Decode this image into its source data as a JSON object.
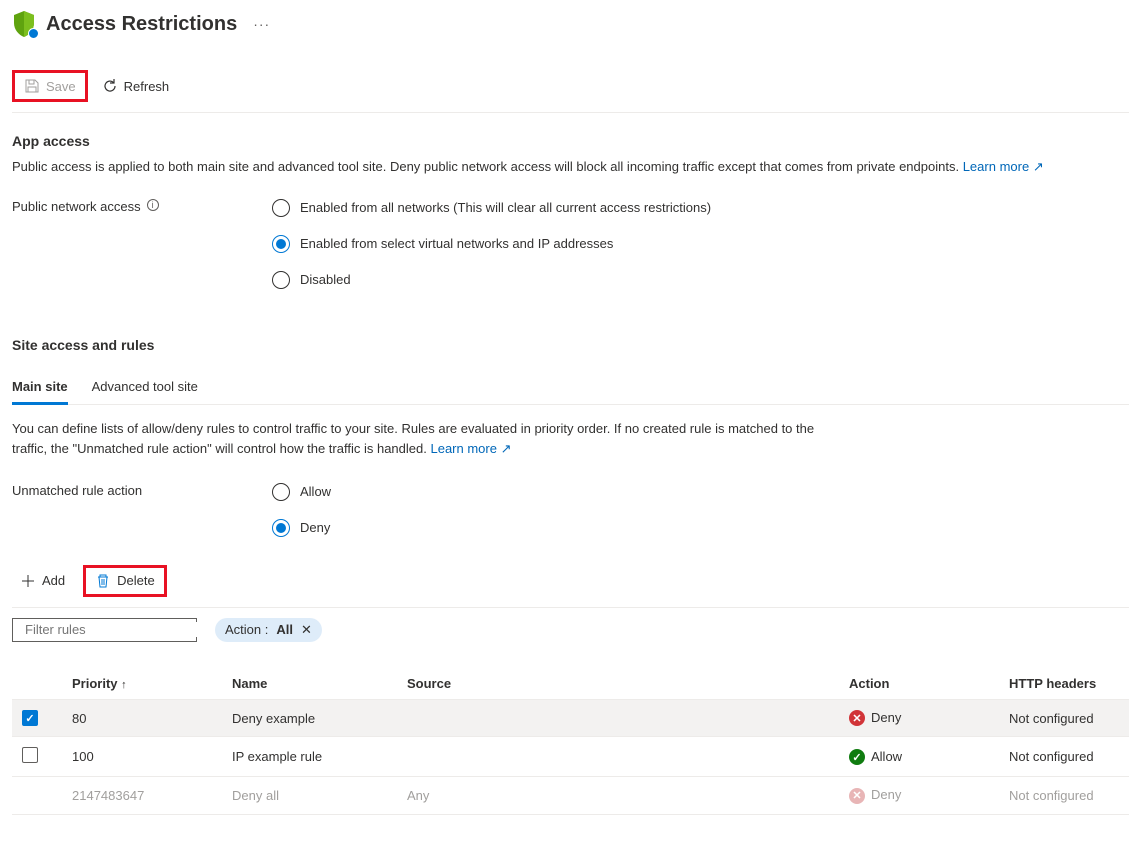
{
  "header": {
    "title": "Access Restrictions"
  },
  "toolbar": {
    "save_label": "Save",
    "refresh_label": "Refresh"
  },
  "app_access": {
    "title": "App access",
    "description": "Public access is applied to both main site and advanced tool site. Deny public network access will block all incoming traffic except that comes from private endpoints.",
    "learn_more": "Learn more",
    "radio_label": "Public network access",
    "options": [
      "Enabled from all networks (This will clear all current access restrictions)",
      "Enabled from select virtual networks and IP addresses",
      "Disabled"
    ],
    "selected_index": 1
  },
  "site_access": {
    "title": "Site access and rules",
    "tabs": [
      "Main site",
      "Advanced tool site"
    ],
    "active_tab": 0,
    "description": "You can define lists of allow/deny rules to control traffic to your site. Rules are evaluated in priority order. If no created rule is matched to the traffic, the \"Unmatched rule action\" will control how the traffic is handled.",
    "learn_more": "Learn more",
    "unmatched_label": "Unmatched rule action",
    "unmatched_options": [
      "Allow",
      "Deny"
    ],
    "unmatched_selected_index": 1
  },
  "actions": {
    "add_label": "Add",
    "delete_label": "Delete"
  },
  "filter": {
    "placeholder": "Filter rules",
    "pill_key": "Action :",
    "pill_value": "All"
  },
  "table": {
    "headers": {
      "priority": "Priority",
      "name": "Name",
      "source": "Source",
      "action": "Action",
      "http": "HTTP headers"
    },
    "rows": [
      {
        "selected": true,
        "priority": "80",
        "name": "Deny example",
        "source": "",
        "action": "Deny",
        "action_kind": "deny",
        "http": "Not configured",
        "faded": false
      },
      {
        "selected": false,
        "priority": "100",
        "name": "IP example rule",
        "source": "",
        "action": "Allow",
        "action_kind": "allow",
        "http": "Not configured",
        "faded": false
      },
      {
        "selected": false,
        "priority": "2147483647",
        "name": "Deny all",
        "source": "Any",
        "action": "Deny",
        "action_kind": "deny",
        "http": "Not configured",
        "faded": true
      }
    ]
  }
}
